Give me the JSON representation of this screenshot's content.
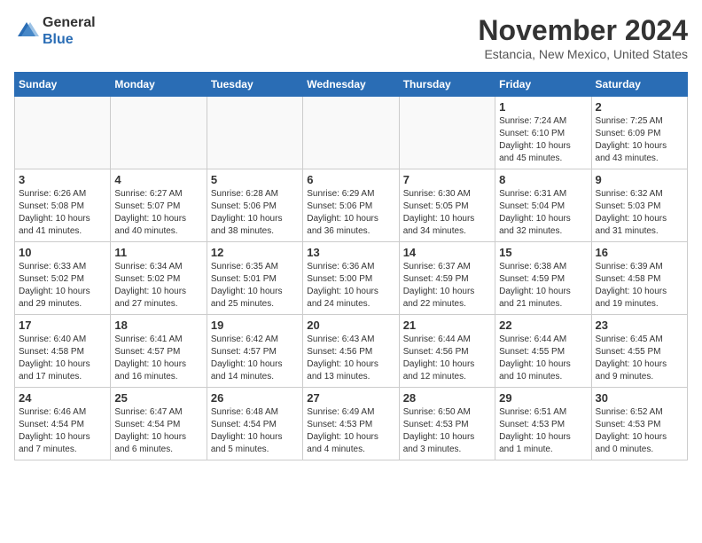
{
  "header": {
    "logo": {
      "general": "General",
      "blue": "Blue"
    },
    "title": "November 2024",
    "location": "Estancia, New Mexico, United States"
  },
  "weekdays": [
    "Sunday",
    "Monday",
    "Tuesday",
    "Wednesday",
    "Thursday",
    "Friday",
    "Saturday"
  ],
  "weeks": [
    [
      {
        "day": "",
        "info": ""
      },
      {
        "day": "",
        "info": ""
      },
      {
        "day": "",
        "info": ""
      },
      {
        "day": "",
        "info": ""
      },
      {
        "day": "",
        "info": ""
      },
      {
        "day": "1",
        "info": "Sunrise: 7:24 AM\nSunset: 6:10 PM\nDaylight: 10 hours\nand 45 minutes."
      },
      {
        "day": "2",
        "info": "Sunrise: 7:25 AM\nSunset: 6:09 PM\nDaylight: 10 hours\nand 43 minutes."
      }
    ],
    [
      {
        "day": "3",
        "info": "Sunrise: 6:26 AM\nSunset: 5:08 PM\nDaylight: 10 hours\nand 41 minutes."
      },
      {
        "day": "4",
        "info": "Sunrise: 6:27 AM\nSunset: 5:07 PM\nDaylight: 10 hours\nand 40 minutes."
      },
      {
        "day": "5",
        "info": "Sunrise: 6:28 AM\nSunset: 5:06 PM\nDaylight: 10 hours\nand 38 minutes."
      },
      {
        "day": "6",
        "info": "Sunrise: 6:29 AM\nSunset: 5:06 PM\nDaylight: 10 hours\nand 36 minutes."
      },
      {
        "day": "7",
        "info": "Sunrise: 6:30 AM\nSunset: 5:05 PM\nDaylight: 10 hours\nand 34 minutes."
      },
      {
        "day": "8",
        "info": "Sunrise: 6:31 AM\nSunset: 5:04 PM\nDaylight: 10 hours\nand 32 minutes."
      },
      {
        "day": "9",
        "info": "Sunrise: 6:32 AM\nSunset: 5:03 PM\nDaylight: 10 hours\nand 31 minutes."
      }
    ],
    [
      {
        "day": "10",
        "info": "Sunrise: 6:33 AM\nSunset: 5:02 PM\nDaylight: 10 hours\nand 29 minutes."
      },
      {
        "day": "11",
        "info": "Sunrise: 6:34 AM\nSunset: 5:02 PM\nDaylight: 10 hours\nand 27 minutes."
      },
      {
        "day": "12",
        "info": "Sunrise: 6:35 AM\nSunset: 5:01 PM\nDaylight: 10 hours\nand 25 minutes."
      },
      {
        "day": "13",
        "info": "Sunrise: 6:36 AM\nSunset: 5:00 PM\nDaylight: 10 hours\nand 24 minutes."
      },
      {
        "day": "14",
        "info": "Sunrise: 6:37 AM\nSunset: 4:59 PM\nDaylight: 10 hours\nand 22 minutes."
      },
      {
        "day": "15",
        "info": "Sunrise: 6:38 AM\nSunset: 4:59 PM\nDaylight: 10 hours\nand 21 minutes."
      },
      {
        "day": "16",
        "info": "Sunrise: 6:39 AM\nSunset: 4:58 PM\nDaylight: 10 hours\nand 19 minutes."
      }
    ],
    [
      {
        "day": "17",
        "info": "Sunrise: 6:40 AM\nSunset: 4:58 PM\nDaylight: 10 hours\nand 17 minutes."
      },
      {
        "day": "18",
        "info": "Sunrise: 6:41 AM\nSunset: 4:57 PM\nDaylight: 10 hours\nand 16 minutes."
      },
      {
        "day": "19",
        "info": "Sunrise: 6:42 AM\nSunset: 4:57 PM\nDaylight: 10 hours\nand 14 minutes."
      },
      {
        "day": "20",
        "info": "Sunrise: 6:43 AM\nSunset: 4:56 PM\nDaylight: 10 hours\nand 13 minutes."
      },
      {
        "day": "21",
        "info": "Sunrise: 6:44 AM\nSunset: 4:56 PM\nDaylight: 10 hours\nand 12 minutes."
      },
      {
        "day": "22",
        "info": "Sunrise: 6:44 AM\nSunset: 4:55 PM\nDaylight: 10 hours\nand 10 minutes."
      },
      {
        "day": "23",
        "info": "Sunrise: 6:45 AM\nSunset: 4:55 PM\nDaylight: 10 hours\nand 9 minutes."
      }
    ],
    [
      {
        "day": "24",
        "info": "Sunrise: 6:46 AM\nSunset: 4:54 PM\nDaylight: 10 hours\nand 7 minutes."
      },
      {
        "day": "25",
        "info": "Sunrise: 6:47 AM\nSunset: 4:54 PM\nDaylight: 10 hours\nand 6 minutes."
      },
      {
        "day": "26",
        "info": "Sunrise: 6:48 AM\nSunset: 4:54 PM\nDaylight: 10 hours\nand 5 minutes."
      },
      {
        "day": "27",
        "info": "Sunrise: 6:49 AM\nSunset: 4:53 PM\nDaylight: 10 hours\nand 4 minutes."
      },
      {
        "day": "28",
        "info": "Sunrise: 6:50 AM\nSunset: 4:53 PM\nDaylight: 10 hours\nand 3 minutes."
      },
      {
        "day": "29",
        "info": "Sunrise: 6:51 AM\nSunset: 4:53 PM\nDaylight: 10 hours\nand 1 minute."
      },
      {
        "day": "30",
        "info": "Sunrise: 6:52 AM\nSunset: 4:53 PM\nDaylight: 10 hours\nand 0 minutes."
      }
    ]
  ]
}
